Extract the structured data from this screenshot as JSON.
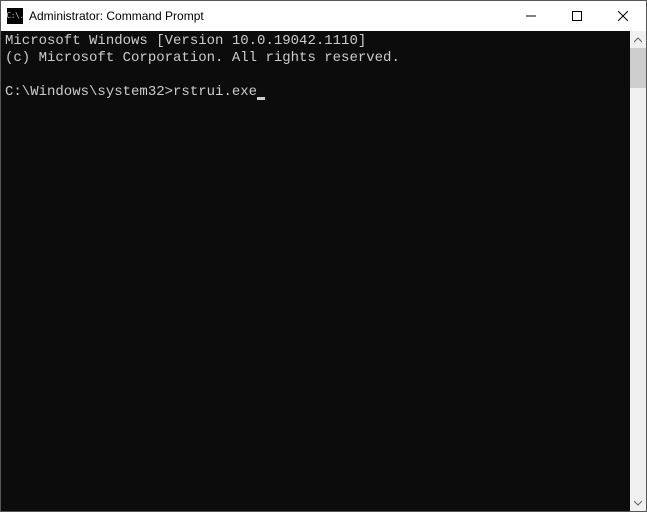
{
  "window": {
    "title": "Administrator: Command Prompt",
    "icon_text": "C:\\."
  },
  "terminal": {
    "line1": "Microsoft Windows [Version 10.0.19042.1110]",
    "line2": "(c) Microsoft Corporation. All rights reserved.",
    "prompt": "C:\\Windows\\system32>",
    "command": "rstrui.exe"
  }
}
